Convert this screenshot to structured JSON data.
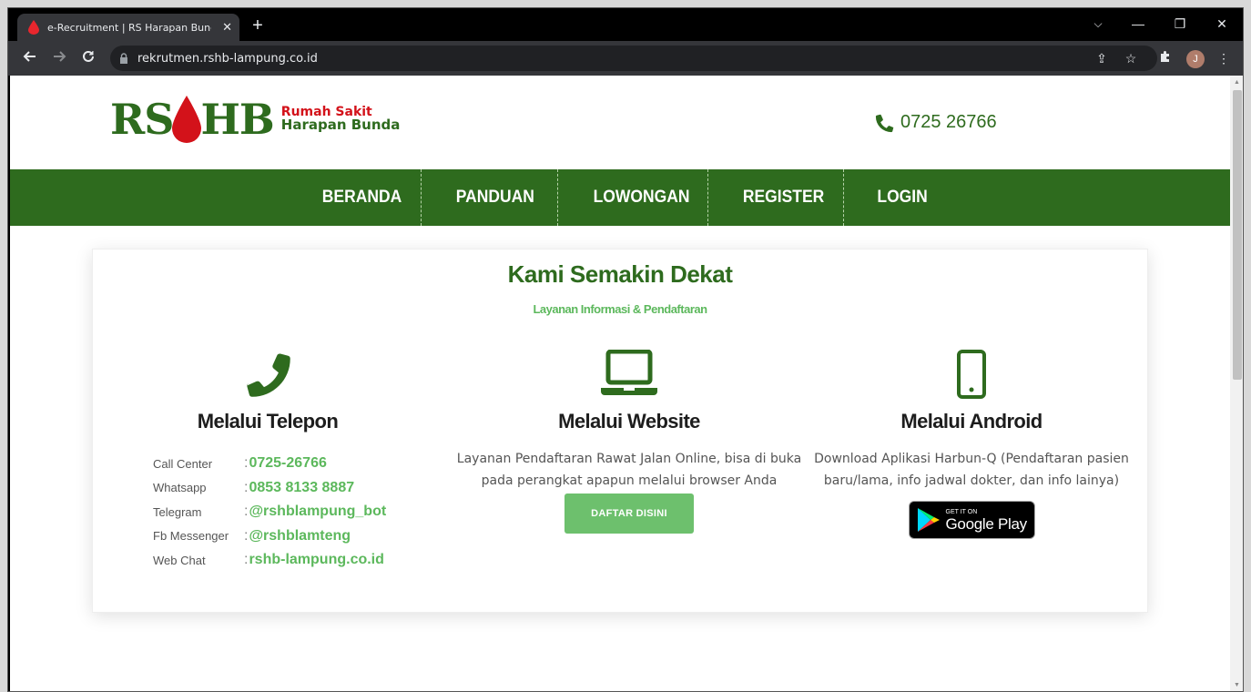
{
  "browser": {
    "tab_title": "e-Recruitment | RS Harapan Bunda",
    "tab_close": "✕",
    "new_tab": "+",
    "url": "rekrutmen.rshb-lampung.co.id",
    "avatar_letter": "J",
    "controls": {
      "dropdown": "⌵",
      "minimize": "—",
      "restore": "❐",
      "close": "✕"
    }
  },
  "site": {
    "logo": {
      "letters_left": "RS",
      "letters_right": "HB",
      "line1": "Rumah Sakit",
      "line2": "Harapan Bunda"
    },
    "phone": "0725 26766",
    "nav": [
      "BERANDA",
      "PANDUAN",
      "LOWONGAN",
      "REGISTER",
      "LOGIN"
    ],
    "colors": {
      "brand_green": "#2e6b1e",
      "accent_green": "#5cb85c",
      "brand_red": "#d3121a"
    }
  },
  "card": {
    "title": "Kami Semakin Dekat",
    "subtitle": "Layanan Informasi & Pendaftaran",
    "telepon": {
      "title": "Melalui Telepon",
      "icon": "phone-icon",
      "contacts": [
        {
          "label": "Call Center",
          "value": "0725-26766"
        },
        {
          "label": "Whatsapp",
          "value": "0853 8133 8887"
        },
        {
          "label": "Telegram",
          "value": "@rshblampung_bot"
        },
        {
          "label": "Fb Messenger",
          "value": "@rshblamteng"
        },
        {
          "label": "Web Chat",
          "value": "rshb-lampung.co.id"
        }
      ]
    },
    "website": {
      "title": "Melalui Website",
      "icon": "laptop-icon",
      "text": "Layanan Pendaftaran Rawat Jalan Online, bisa di buka pada perangkat apapun melalui browser Anda",
      "button": "DAFTAR DISINI"
    },
    "android": {
      "title": "Melalui Android",
      "icon": "mobile-icon",
      "text": "Download Aplikasi Harbun-Q (Pendaftaran pasien baru/lama, info jadwal dokter, dan info lainya)",
      "badge_small": "GET IT ON",
      "badge_big": "Google Play"
    }
  }
}
